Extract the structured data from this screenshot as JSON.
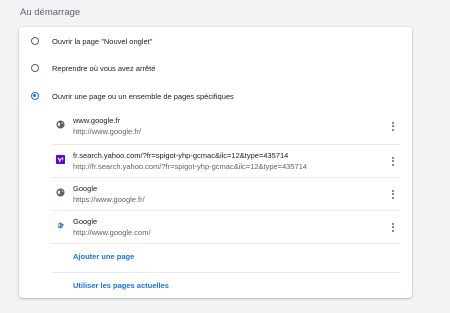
{
  "section": {
    "title": "Au démarrage"
  },
  "options": [
    {
      "label": "Ouvrir la page \"Nouvel onglet\"",
      "checked": false
    },
    {
      "label": "Reprendre où vous avez arrêté",
      "checked": false
    },
    {
      "label": "Ouvrir une page ou un ensemble de pages spécifiques",
      "checked": true
    }
  ],
  "pages": [
    {
      "title": "www.google.fr",
      "url": "http://www.google.fr/",
      "icon": "globe-icon"
    },
    {
      "title": "fr.search.yahoo.com/?fr=spigot-yhp-gcmac&ilc=12&type=435714",
      "url": "http://fr.search.yahoo.com/?fr=spigot-yhp-gcmac&ilc=12&type=435714",
      "icon": "yahoo-icon"
    },
    {
      "title": "Google",
      "url": "https://www.google.fr/",
      "icon": "globe-icon"
    },
    {
      "title": "Google",
      "url": "http://www.google.com/",
      "icon": "google-g-icon"
    }
  ],
  "actions": {
    "add_page": "Ajouter une page",
    "use_current": "Utiliser les pages actuelles"
  },
  "colors": {
    "accent": "#1a73e8",
    "background": "#f1f3f4",
    "card": "#ffffff",
    "yahoo": "#6001d2"
  }
}
